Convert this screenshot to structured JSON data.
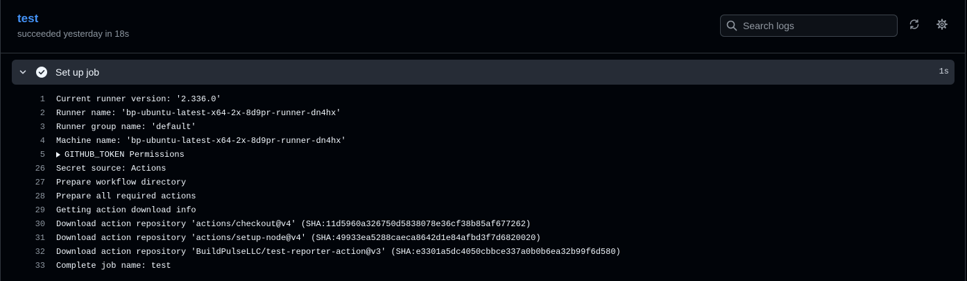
{
  "header": {
    "job_title": "test",
    "job_status": "succeeded yesterday in 18s"
  },
  "search": {
    "placeholder": "Search logs",
    "value": ""
  },
  "toolbar": {
    "refresh_icon": "sync-icon",
    "settings_icon": "gear-icon"
  },
  "step": {
    "name": "Set up job",
    "duration": "1s",
    "status": "success",
    "expanded": true
  },
  "log": {
    "lines": [
      {
        "num": "1",
        "text": "Current runner version: '2.336.0'"
      },
      {
        "num": "2",
        "text": "Runner name: 'bp-ubuntu-latest-x64-2x-8d9pr-runner-dn4hx'"
      },
      {
        "num": "3",
        "text": "Runner group name: 'default'"
      },
      {
        "num": "4",
        "text": "Machine name: 'bp-ubuntu-latest-x64-2x-8d9pr-runner-dn4hx'"
      },
      {
        "num": "5",
        "text": "GITHUB_TOKEN Permissions"
      },
      {
        "num": "26",
        "text": "Secret source: Actions"
      },
      {
        "num": "27",
        "text": "Prepare workflow directory"
      },
      {
        "num": "28",
        "text": "Prepare all required actions"
      },
      {
        "num": "29",
        "text": "Getting action download info"
      },
      {
        "num": "30",
        "text": "Download action repository 'actions/checkout@v4' (SHA:11d5960a326750d5838078e36cf38b85af677262)"
      },
      {
        "num": "31",
        "text": "Download action repository 'actions/setup-node@v4' (SHA:49933ea5288caeca8642d1e84afbd3f7d6820020)"
      },
      {
        "num": "32",
        "text": "Download action repository 'BuildPulseLLC/test-reporter-action@v3' (SHA:e3301a5dc4050cbbce337a0b0b6ea32b99f6d580)"
      },
      {
        "num": "33",
        "text": "Complete job name: test"
      }
    ]
  },
  "colors": {
    "background": "#010409",
    "link": "#4493f8",
    "step_bg": "#262c36",
    "muted": "#8d96a0"
  }
}
